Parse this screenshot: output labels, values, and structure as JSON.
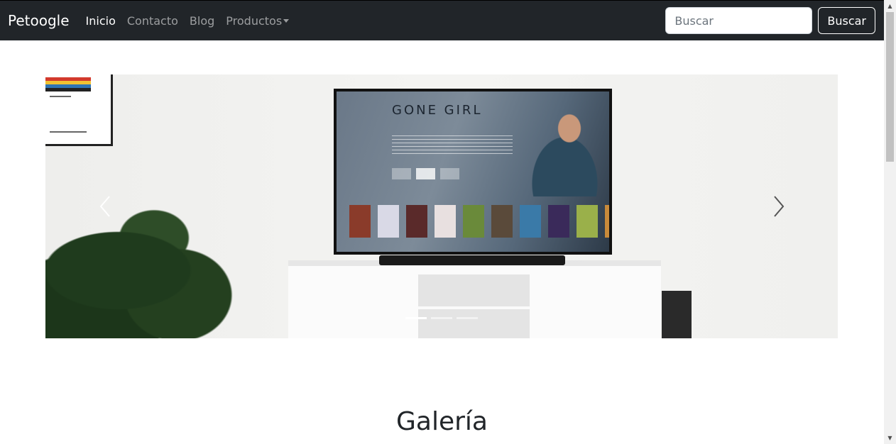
{
  "navbar": {
    "brand": "Petoogle",
    "links": [
      {
        "label": "Inicio",
        "active": true
      },
      {
        "label": "Contacto",
        "active": false
      },
      {
        "label": "Blog",
        "active": false
      },
      {
        "label": "Productos",
        "active": false,
        "dropdown": true
      }
    ],
    "search": {
      "placeholder": "Buscar",
      "button_label": "Buscar"
    },
    "background_color": "#212529"
  },
  "carousel": {
    "slide_count": 3,
    "active_slide": 1,
    "tv_title": "GONE GIRL",
    "icons": {
      "prev": "chevron-left-icon",
      "next": "chevron-right-icon"
    }
  },
  "main": {
    "section_title": "Galería"
  }
}
